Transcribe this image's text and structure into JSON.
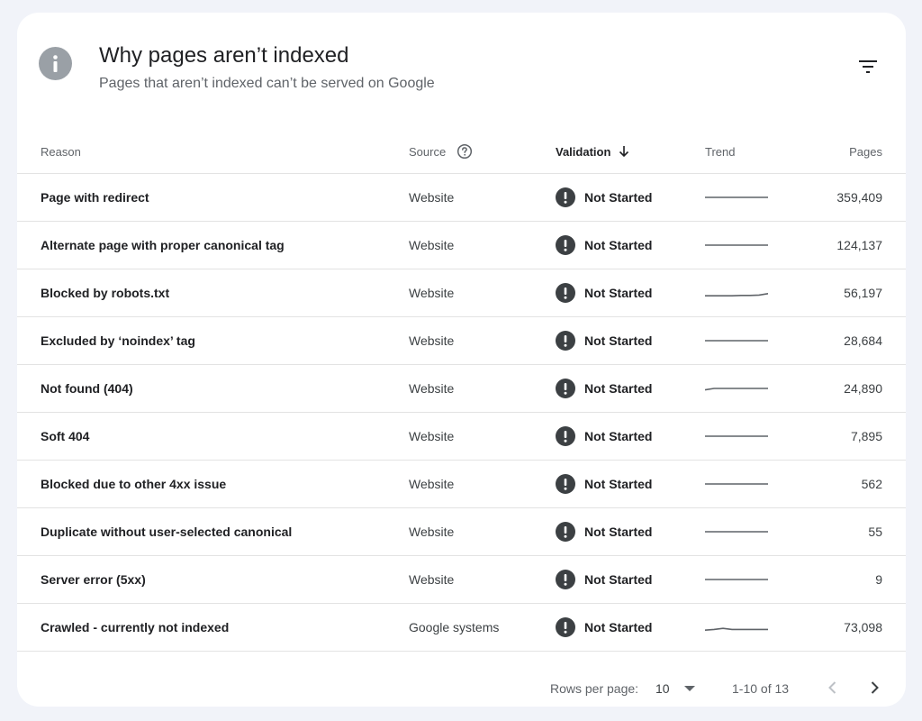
{
  "header": {
    "title": "Why pages aren’t indexed",
    "subtitle": "Pages that aren’t indexed can’t be served on Google",
    "info_icon": "info-icon",
    "filter_icon": "filter-icon"
  },
  "table": {
    "columns": {
      "reason": "Reason",
      "source": "Source",
      "validation": "Validation",
      "trend": "Trend",
      "pages": "Pages"
    },
    "rows": [
      {
        "reason": "Page with redirect",
        "source": "Website",
        "validation": "Not Started",
        "pages": "359,409",
        "trend": [
          1,
          1,
          1,
          1,
          1,
          1,
          1,
          1
        ]
      },
      {
        "reason": "Alternate page with proper canonical tag",
        "source": "Website",
        "validation": "Not Started",
        "pages": "124,137",
        "trend": [
          1,
          1,
          1,
          1,
          1,
          1,
          1,
          1
        ]
      },
      {
        "reason": "Blocked by robots.txt",
        "source": "Website",
        "validation": "Not Started",
        "pages": "56,197",
        "trend": [
          0.2,
          0.2,
          0.2,
          0.2,
          0.3,
          0.3,
          0.4,
          0.8
        ]
      },
      {
        "reason": "Excluded by ‘noindex’ tag",
        "source": "Website",
        "validation": "Not Started",
        "pages": "28,684",
        "trend": [
          1,
          1,
          1,
          1,
          1,
          1,
          1,
          1
        ]
      },
      {
        "reason": "Not found (404)",
        "source": "Website",
        "validation": "Not Started",
        "pages": "24,890",
        "trend": [
          0.6,
          1,
          1,
          1,
          1,
          1,
          1,
          1
        ]
      },
      {
        "reason": "Soft 404",
        "source": "Website",
        "validation": "Not Started",
        "pages": "7,895",
        "trend": [
          1,
          1,
          1,
          1,
          1,
          1,
          1,
          1
        ]
      },
      {
        "reason": "Blocked due to other 4xx issue",
        "source": "Website",
        "validation": "Not Started",
        "pages": "562",
        "trend": [
          1,
          1,
          1,
          1,
          1,
          1,
          1,
          1
        ]
      },
      {
        "reason": "Duplicate without user-selected canonical",
        "source": "Website",
        "validation": "Not Started",
        "pages": "55",
        "trend": [
          1,
          1,
          1,
          1,
          1,
          1,
          1,
          1
        ]
      },
      {
        "reason": "Server error (5xx)",
        "source": "Website",
        "validation": "Not Started",
        "pages": "9",
        "trend": [
          1,
          1,
          1,
          1,
          1,
          1,
          1,
          1
        ]
      },
      {
        "reason": "Crawled - currently not indexed",
        "source": "Google systems",
        "validation": "Not Started",
        "pages": "73,098",
        "trend": [
          0.2,
          0.4,
          0.7,
          0.4,
          0.4,
          0.4,
          0.4,
          0.4
        ]
      }
    ]
  },
  "footer": {
    "rows_per_page_label": "Rows per page:",
    "rows_per_page_value": "10",
    "range": "1-10 of 13",
    "prev_icon": "chevron-left-icon",
    "next_icon": "chevron-right-icon"
  },
  "colors": {
    "background": "#f1f3f9",
    "card": "#ffffff",
    "status_icon": "#3c4043",
    "info_badge": "#9aa0a6",
    "trend_line": "#5f6368",
    "divider": "#e3e3e3"
  }
}
